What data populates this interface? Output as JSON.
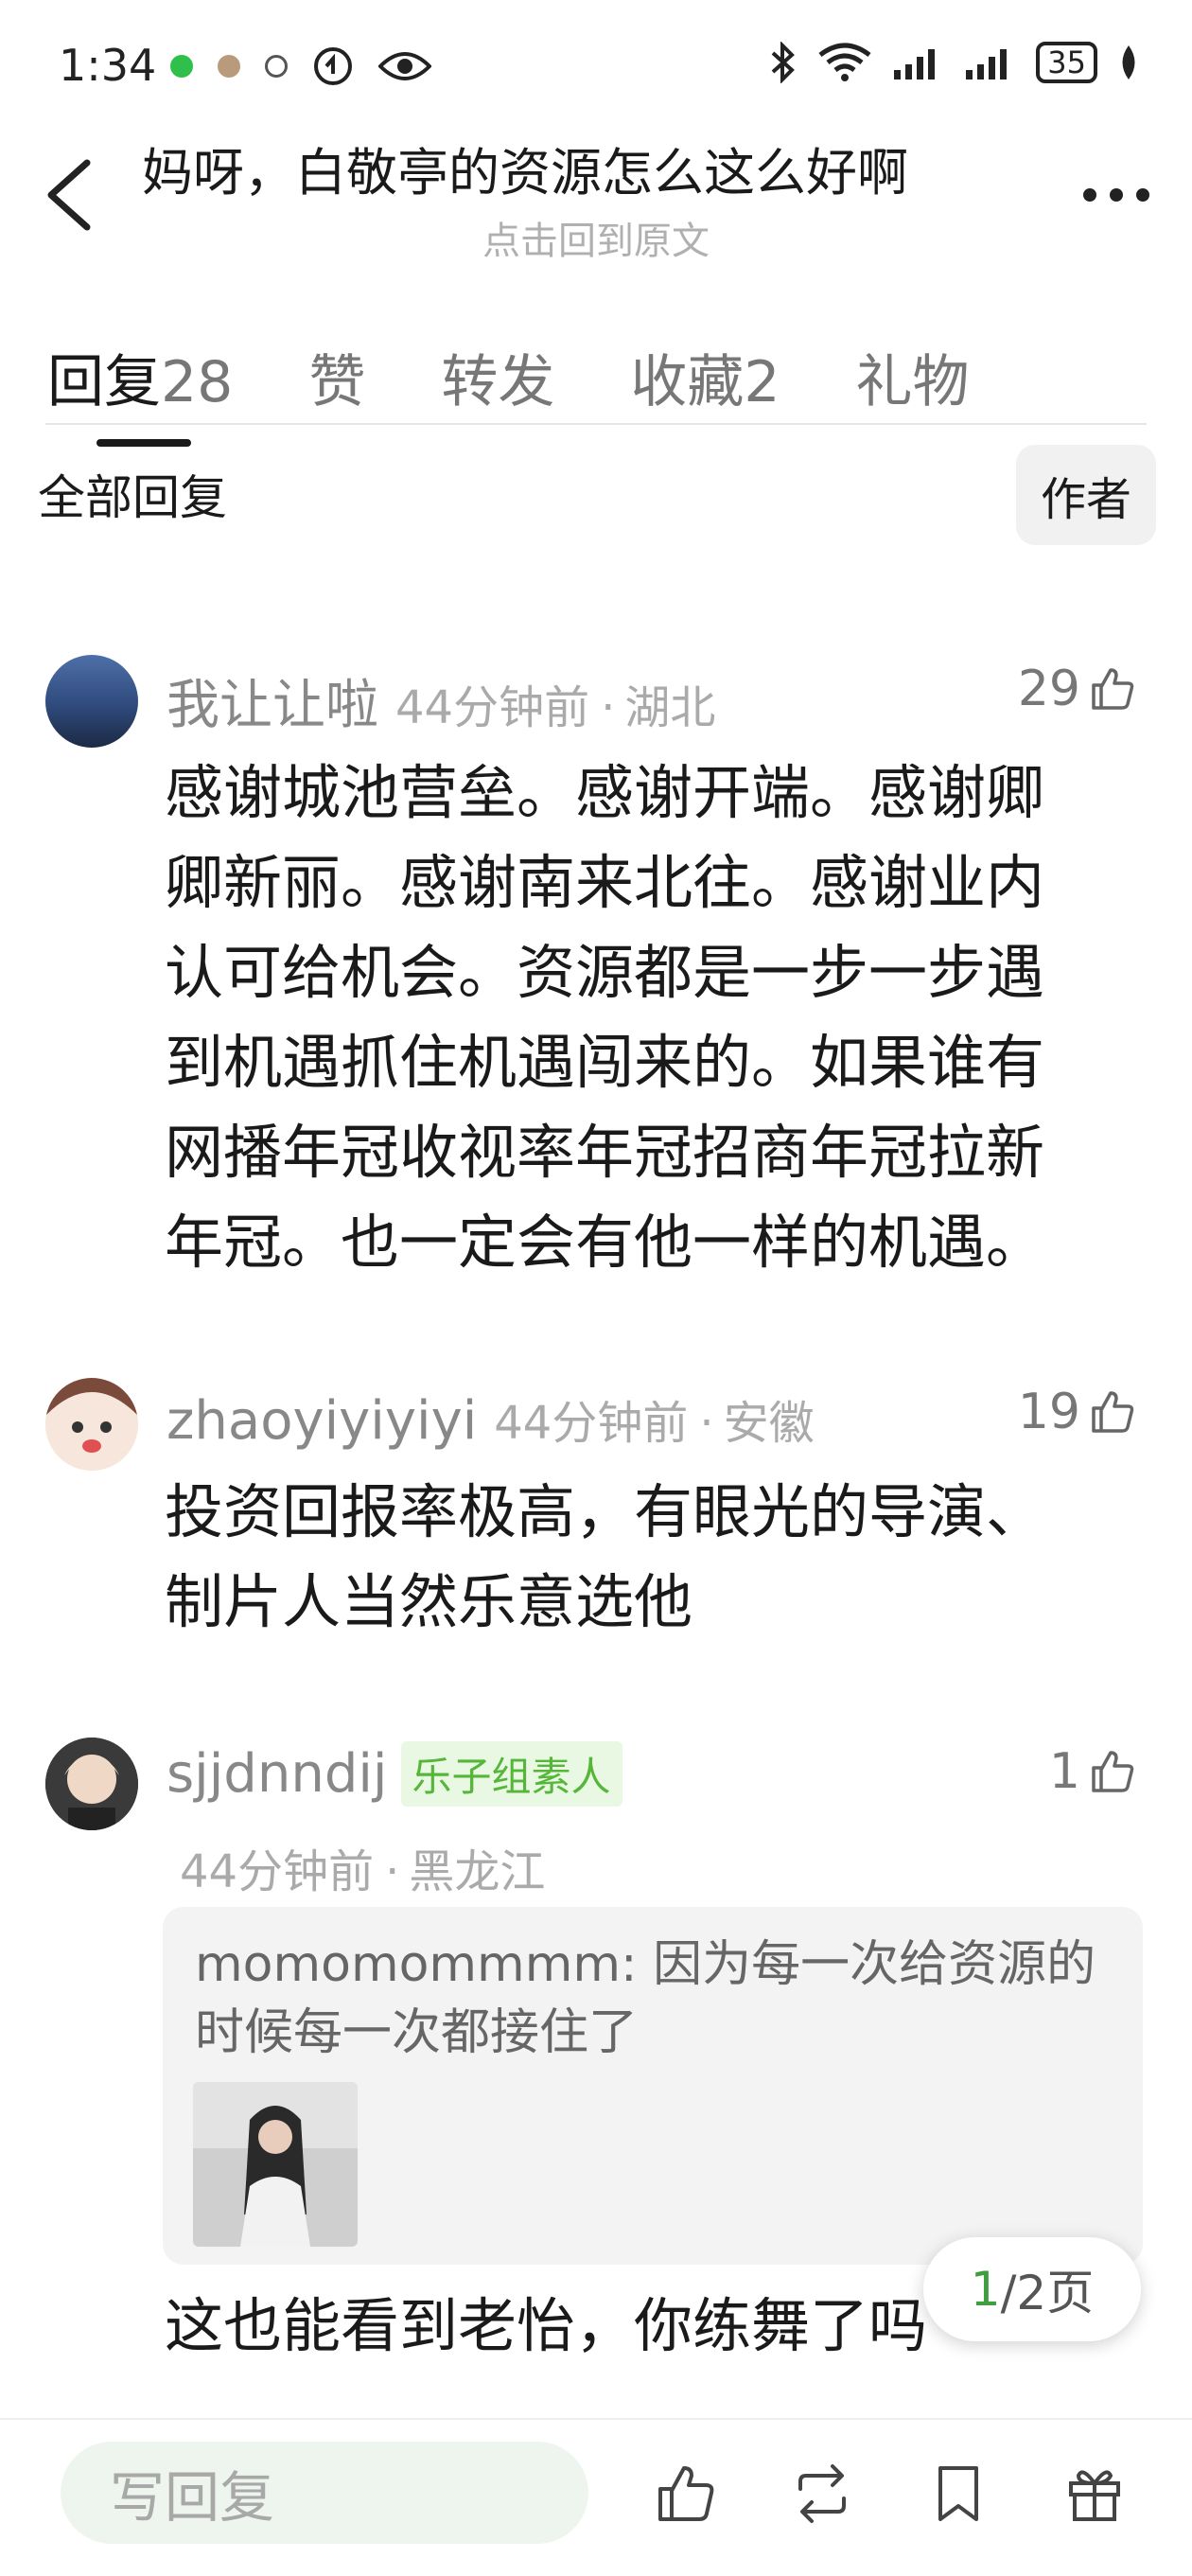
{
  "status": {
    "time": "1:34",
    "battery": "35"
  },
  "header": {
    "title": "妈呀，白敬亭的资源怎么这么好啊",
    "subtitle": "点击回到原文"
  },
  "tabs": [
    {
      "label": "回复",
      "count": "28",
      "active": true
    },
    {
      "label": "赞",
      "count": ""
    },
    {
      "label": "转发",
      "count": ""
    },
    {
      "label": "收藏",
      "count": "2"
    },
    {
      "label": "礼物",
      "count": ""
    }
  ],
  "filter": {
    "all_label": "全部回复",
    "author_label": "作者"
  },
  "comments": [
    {
      "user": "我让让啦",
      "time": "44分钟前",
      "location": "湖北",
      "likes": "29",
      "lines": [
        "感谢城池营垒。感谢开端。感谢卿",
        "卿新丽。感谢南来北往。感谢业内",
        "认可给机会。资源都是一步一步遇",
        "到机遇抓住机遇闯来的。如果谁有",
        "网播年冠收视率年冠招商年冠拉新",
        "年冠。也一定会有他一样的机遇。"
      ]
    },
    {
      "user": "zhaoyiyiyiyi",
      "time": "44分钟前",
      "location": "安徽",
      "likes": "19",
      "lines": [
        "投资回报率极高，有眼光的导演、",
        "制片人当然乐意选他"
      ]
    },
    {
      "user": "sjjdnndij",
      "badge": "乐子组素人",
      "time": "44分钟前",
      "location": "黑龙江",
      "likes": "1",
      "quote_user": "momomommmm",
      "quote_text_1": ": 因为每一次给资源的",
      "quote_text_2": "时候每一次都接住了",
      "text": "这也能看到老怡，你练舞了吗"
    }
  ],
  "pager": {
    "current": "1",
    "total": "/2页"
  },
  "bottom": {
    "reply_placeholder": "写回复"
  },
  "colors": {
    "accent": "#3f9f3f",
    "badge_bg": "#e9f8e3",
    "badge_text": "#56b63a"
  }
}
